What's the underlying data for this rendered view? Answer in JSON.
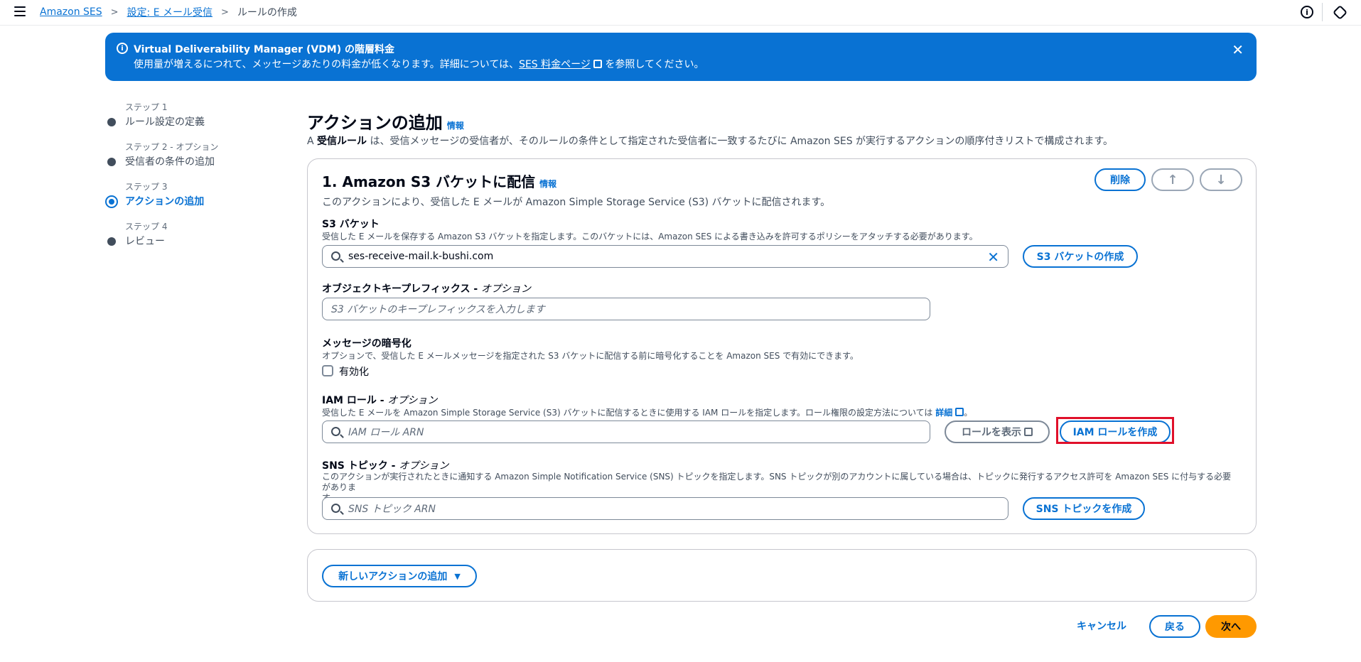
{
  "breadcrumb": {
    "items": [
      "Amazon SES",
      "設定: E メール受信"
    ],
    "current": "ルールの作成"
  },
  "banner": {
    "title": "Virtual Deliverability Manager (VDM) の階層料金",
    "body_prefix": "使用量が増えるにつれて、メッセージあたりの料金が低くなります。詳細については、",
    "link": "SES 料金ページ",
    "body_suffix": " を参照してください。"
  },
  "steps": [
    {
      "sub": "ステップ 1",
      "label": "ルール設定の定義"
    },
    {
      "sub": "ステップ 2 - オプション",
      "label": "受信者の条件の追加"
    },
    {
      "sub": "ステップ 3",
      "label": "アクションの追加"
    },
    {
      "sub": "ステップ 4",
      "label": "レビュー"
    }
  ],
  "main": {
    "title": "アクションの追加",
    "info": "情報",
    "desc_prefix": "A ",
    "desc_bold": "受信ルール",
    "desc_suffix": " は、受信メッセージの受信者が、そのルールの条件として指定された受信者に一致するたびに Amazon SES が実行するアクションの順序付きリストで構成されます。"
  },
  "action": {
    "title": "1. Amazon S3 バケットに配信",
    "info": "情報",
    "desc": "このアクションにより、受信した E メールが Amazon Simple Storage Service (S3) バケットに配信されます。",
    "delete": "削除",
    "up": "↑",
    "down": "↓",
    "s3": {
      "label": "S3 バケット",
      "desc": "受信した E メールを保存する Amazon S3 バケットを指定します。このバケットには、Amazon SES による書き込みを許可するポリシーをアタッチする必要があります。",
      "value": "ses-receive-mail.k-bushi.com",
      "clear": "✕",
      "create": "S3 バケットの作成"
    },
    "prefix": {
      "label": "オブジェクトキープレフィックス",
      "optional": "オプション",
      "placeholder": "S3 バケットのキープレフィックスを入力します"
    },
    "encrypt": {
      "label": "メッセージの暗号化",
      "desc": "オプションで、受信した E メールメッセージを指定された S3 バケットに配信する前に暗号化することを Amazon SES で有効にできます。",
      "checkbox": "有効化"
    },
    "iam": {
      "label": "IAM ロール",
      "optional": "オプション",
      "desc": "受信した E メールを Amazon Simple Storage Service (S3) バケットに配信するときに使用する IAM ロールを指定します。ロール権限の設定方法については ",
      "desc_link": "詳細",
      "placeholder": "IAM ロール ARN",
      "view": "ロールを表示",
      "create": "IAM ロールを作成"
    },
    "sns": {
      "label": "SNS トピック",
      "optional": "オプション",
      "desc": "このアクションが実行されたときに通知する Amazon Simple Notification Service (SNS) トピックを指定します。SNS トピックが別のアカウントに属している場合は、トピックに発行するアクセス許可を Amazon SES に付与する必要がありま",
      "desc2": "す。",
      "placeholder": "SNS トピック ARN",
      "create": "SNS トピックを作成"
    }
  },
  "add_action": "新しいアクションの追加",
  "footer": {
    "cancel": "キャンセル",
    "back": "戻る",
    "next": "次へ"
  }
}
